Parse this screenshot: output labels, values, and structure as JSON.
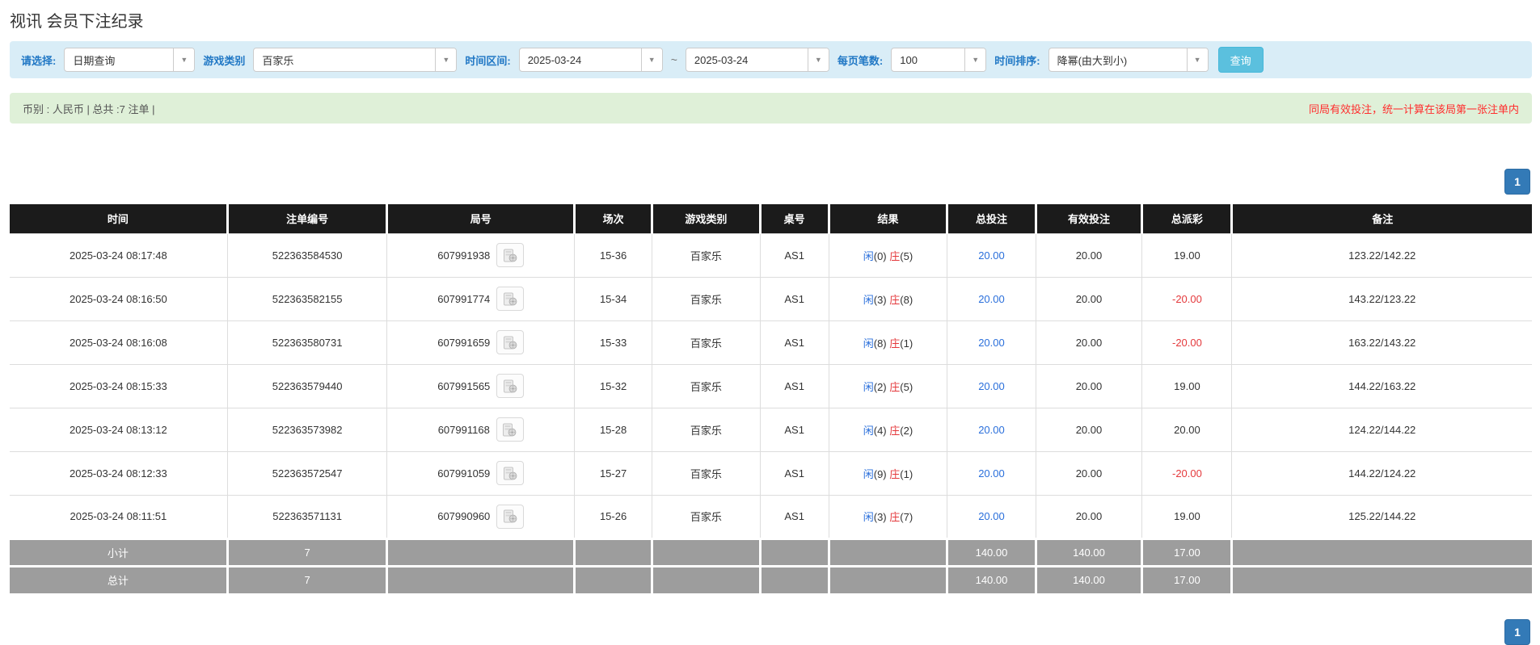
{
  "page": {
    "title": "视讯 会员下注纪录"
  },
  "filters": {
    "select_label": "请选择:",
    "select_value": "日期查询",
    "game_label": "游戏类别",
    "game_value": "百家乐",
    "range_label": "时间区间:",
    "date_from": "2025-03-24",
    "tilde": "~",
    "date_to": "2025-03-24",
    "per_page_label": "每页笔数:",
    "per_page_value": "100",
    "sort_label": "时间排序:",
    "sort_value": "降幂(由大到小)",
    "search_button": "查询"
  },
  "summary_bar": {
    "left": "币别 : 人民币 | 总共 :7 注单 |",
    "right": "同局有效投注，统一计算在该局第一张注单内"
  },
  "pagination": {
    "page": "1"
  },
  "table": {
    "headers": [
      "时间",
      "注单编号",
      "局号",
      "场次",
      "游戏类别",
      "桌号",
      "结果",
      "总投注",
      "有效投注",
      "总派彩",
      "备注"
    ],
    "row_icon": "video-clip-icon",
    "rows": [
      {
        "time": "2025-03-24 08:17:48",
        "bet_id": "522363584530",
        "round_id": "607991938",
        "session": "15-36",
        "game": "百家乐",
        "table_no": "AS1",
        "player_label": "闲",
        "player_num": "(0)",
        "banker_label": "庄",
        "banker_num": "(5)",
        "total_bet": "20.00",
        "valid_bet": "20.00",
        "payout": "19.00",
        "note": "123.22/142.22"
      },
      {
        "time": "2025-03-24 08:16:50",
        "bet_id": "522363582155",
        "round_id": "607991774",
        "session": "15-34",
        "game": "百家乐",
        "table_no": "AS1",
        "player_label": "闲",
        "player_num": "(3)",
        "banker_label": "庄",
        "banker_num": "(8)",
        "total_bet": "20.00",
        "valid_bet": "20.00",
        "payout": "-20.00",
        "note": "143.22/123.22"
      },
      {
        "time": "2025-03-24 08:16:08",
        "bet_id": "522363580731",
        "round_id": "607991659",
        "session": "15-33",
        "game": "百家乐",
        "table_no": "AS1",
        "player_label": "闲",
        "player_num": "(8)",
        "banker_label": "庄",
        "banker_num": "(1)",
        "total_bet": "20.00",
        "valid_bet": "20.00",
        "payout": "-20.00",
        "note": "163.22/143.22"
      },
      {
        "time": "2025-03-24 08:15:33",
        "bet_id": "522363579440",
        "round_id": "607991565",
        "session": "15-32",
        "game": "百家乐",
        "table_no": "AS1",
        "player_label": "闲",
        "player_num": "(2)",
        "banker_label": "庄",
        "banker_num": "(5)",
        "total_bet": "20.00",
        "valid_bet": "20.00",
        "payout": "19.00",
        "note": "144.22/163.22"
      },
      {
        "time": "2025-03-24 08:13:12",
        "bet_id": "522363573982",
        "round_id": "607991168",
        "session": "15-28",
        "game": "百家乐",
        "table_no": "AS1",
        "player_label": "闲",
        "player_num": "(4)",
        "banker_label": "庄",
        "banker_num": "(2)",
        "total_bet": "20.00",
        "valid_bet": "20.00",
        "payout": "20.00",
        "note": "124.22/144.22"
      },
      {
        "time": "2025-03-24 08:12:33",
        "bet_id": "522363572547",
        "round_id": "607991059",
        "session": "15-27",
        "game": "百家乐",
        "table_no": "AS1",
        "player_label": "闲",
        "player_num": "(9)",
        "banker_label": "庄",
        "banker_num": "(1)",
        "total_bet": "20.00",
        "valid_bet": "20.00",
        "payout": "-20.00",
        "note": "144.22/124.22"
      },
      {
        "time": "2025-03-24 08:11:51",
        "bet_id": "522363571131",
        "round_id": "607990960",
        "session": "15-26",
        "game": "百家乐",
        "table_no": "AS1",
        "player_label": "闲",
        "player_num": "(3)",
        "banker_label": "庄",
        "banker_num": "(7)",
        "total_bet": "20.00",
        "valid_bet": "20.00",
        "payout": "19.00",
        "note": "125.22/144.22"
      }
    ],
    "subtotal": {
      "label": "小计",
      "count": "7",
      "total_bet": "140.00",
      "valid_bet": "140.00",
      "payout": "17.00"
    },
    "total": {
      "label": "总计",
      "count": "7",
      "total_bet": "140.00",
      "valid_bet": "140.00",
      "payout": "17.00"
    }
  },
  "colors": {
    "accent_blue": "#2178c5",
    "button_cyan": "#5bc0de",
    "link_blue": "#2a6fdb",
    "result_player": "#2a6fdb",
    "result_banker": "#e4393c",
    "negative_red": "#e4393c",
    "alert_red": "#ff2d2d",
    "header_bg": "#1b1b1b",
    "summary_bg": "#9d9d9d",
    "panel_blue": "#d9edf7",
    "panel_green": "#dff0d8",
    "pagination_blue": "#337ab7"
  }
}
